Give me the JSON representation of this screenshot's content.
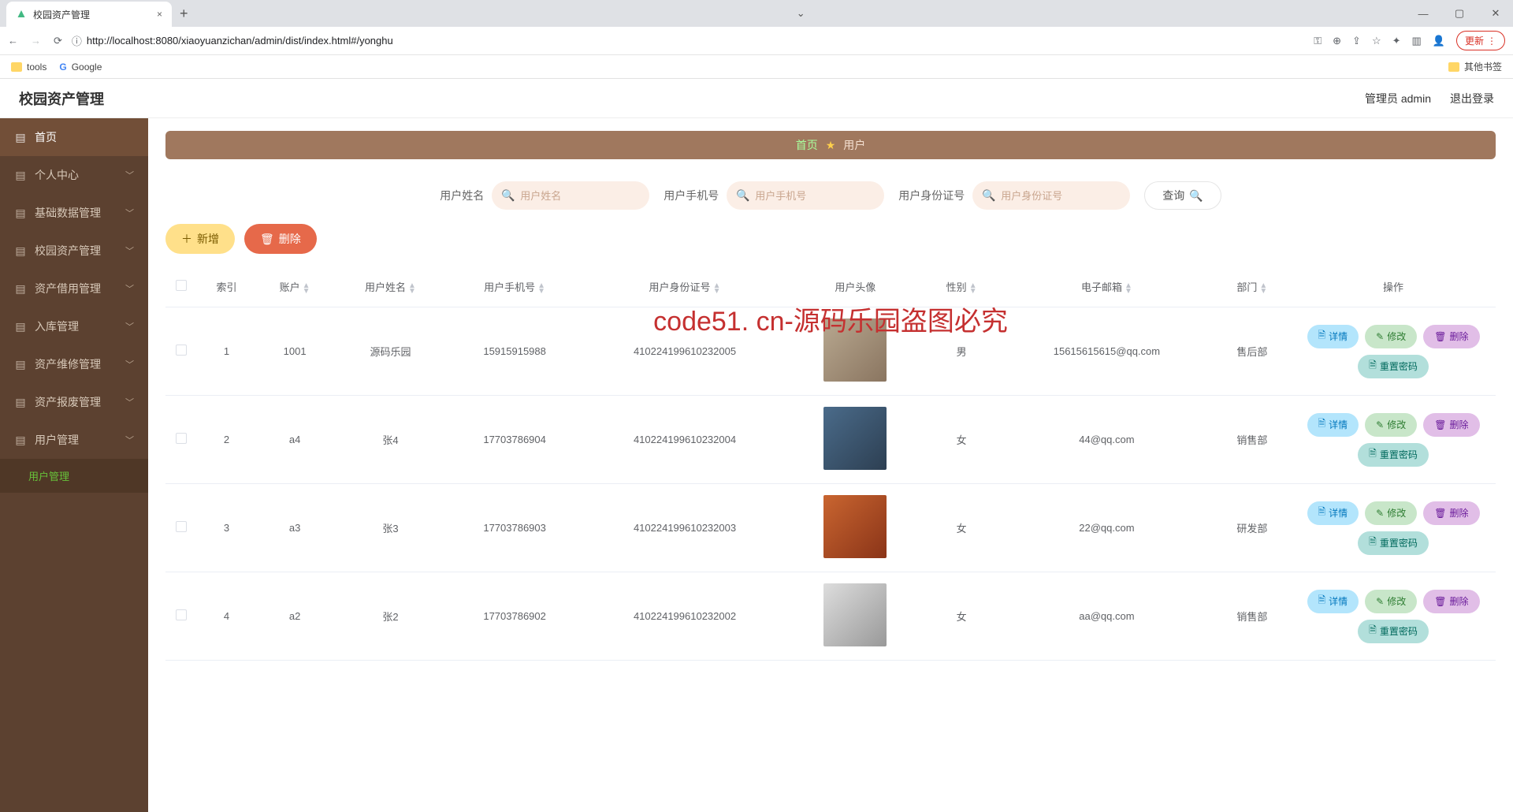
{
  "browser": {
    "tab_title": "校园资产管理",
    "url": "http://localhost:8080/xiaoyuanzichan/admin/dist/index.html#/yonghu",
    "update_label": "更新",
    "bookmarks": {
      "tools": "tools",
      "google": "Google",
      "other": "其他书签"
    }
  },
  "header": {
    "app_title": "校园资产管理",
    "user_label": "管理员 admin",
    "logout_label": "退出登录"
  },
  "sidebar": {
    "items": [
      {
        "label": "首页",
        "icon": "home-icon",
        "expandable": false,
        "active": true
      },
      {
        "label": "个人中心",
        "icon": "user-icon",
        "expandable": true
      },
      {
        "label": "基础数据管理",
        "icon": "data-icon",
        "expandable": true
      },
      {
        "label": "校园资产管理",
        "icon": "list-icon",
        "expandable": true
      },
      {
        "label": "资产借用管理",
        "icon": "tag-icon",
        "expandable": true
      },
      {
        "label": "入库管理",
        "icon": "in-icon",
        "expandable": true
      },
      {
        "label": "资产维修管理",
        "icon": "repair-icon",
        "expandable": true
      },
      {
        "label": "资产报废管理",
        "icon": "scrap-icon",
        "expandable": true
      },
      {
        "label": "用户管理",
        "icon": "users-icon",
        "expandable": true,
        "expanded": true
      }
    ],
    "sub_item": "用户管理"
  },
  "breadcrumb": {
    "home": "首页",
    "current": "用户"
  },
  "search": {
    "name_label": "用户姓名",
    "name_placeholder": "用户姓名",
    "phone_label": "用户手机号",
    "phone_placeholder": "用户手机号",
    "id_label": "用户身份证号",
    "id_placeholder": "用户身份证号",
    "query_label": "查询"
  },
  "actions": {
    "add_label": "新增",
    "delete_label": "删除"
  },
  "table": {
    "headers": {
      "index": "索引",
      "account": "账户",
      "name": "用户姓名",
      "phone": "用户手机号",
      "idcard": "用户身份证号",
      "avatar": "用户头像",
      "gender": "性别",
      "email": "电子邮箱",
      "dept": "部门",
      "ops": "操作"
    },
    "op_labels": {
      "detail": "详情",
      "edit": "修改",
      "delete": "删除",
      "reset": "重置密码"
    },
    "rows": [
      {
        "index": "1",
        "account": "1001",
        "name": "源码乐园",
        "phone": "15915915988",
        "idcard": "410224199610232005",
        "gender": "男",
        "email": "15615615615@qq.com",
        "dept": "售后部",
        "avatar_cls": ""
      },
      {
        "index": "2",
        "account": "a4",
        "name": "张4",
        "phone": "17703786904",
        "idcard": "410224199610232004",
        "gender": "女",
        "email": "44@qq.com",
        "dept": "销售部",
        "avatar_cls": "b"
      },
      {
        "index": "3",
        "account": "a3",
        "name": "张3",
        "phone": "17703786903",
        "idcard": "410224199610232003",
        "gender": "女",
        "email": "22@qq.com",
        "dept": "研发部",
        "avatar_cls": "c"
      },
      {
        "index": "4",
        "account": "a2",
        "name": "张2",
        "phone": "17703786902",
        "idcard": "410224199610232002",
        "gender": "女",
        "email": "aa@qq.com",
        "dept": "销售部",
        "avatar_cls": "d"
      }
    ]
  },
  "watermark": {
    "big": "code51. cn-源码乐园盗图必究",
    "small": "code51.cn"
  }
}
